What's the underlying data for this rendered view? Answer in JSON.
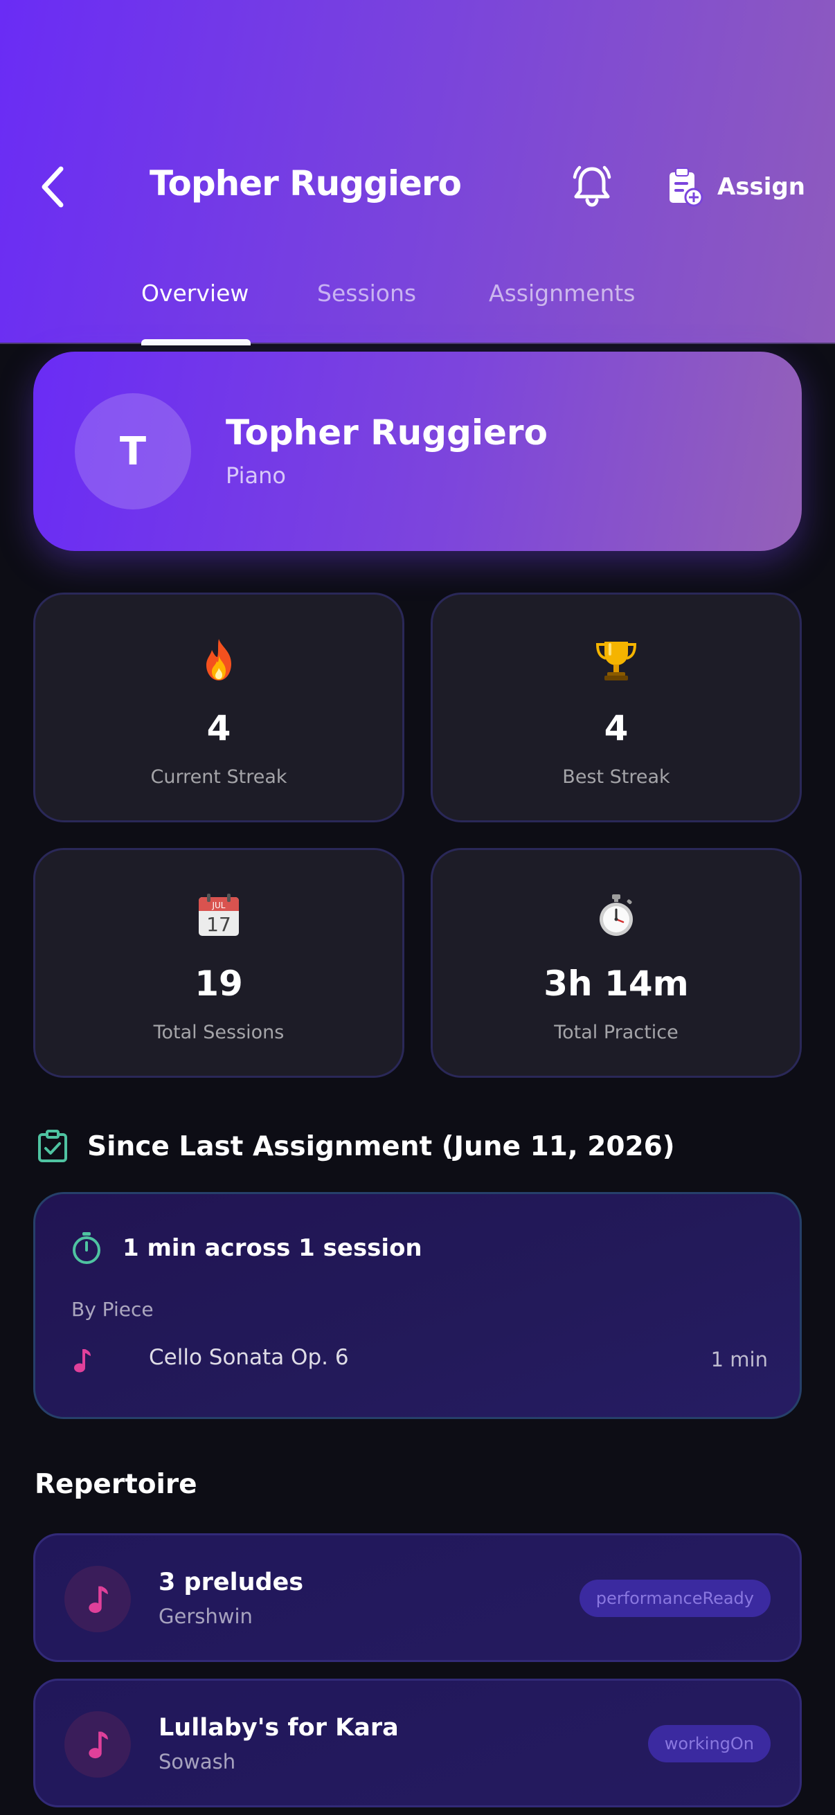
{
  "header": {
    "title": "Topher Ruggiero",
    "assign_label": "Assign",
    "icons": [
      "chevron-left-icon",
      "bell-icon",
      "clipboard-add-icon"
    ]
  },
  "tabs": [
    {
      "label": "Overview",
      "active": true
    },
    {
      "label": "Sessions",
      "active": false
    },
    {
      "label": "Assignments",
      "active": false
    }
  ],
  "profile": {
    "avatar_initial": "T",
    "name": "Topher Ruggiero",
    "instrument": "Piano"
  },
  "stats": [
    {
      "icon": "fire-icon",
      "value": "4",
      "label": "Current Streak"
    },
    {
      "icon": "trophy-icon",
      "value": "4",
      "label": "Best Streak"
    },
    {
      "icon": "calendar-icon",
      "value": "19",
      "label": "Total Sessions",
      "calendar_month": "JUL",
      "calendar_day": "17"
    },
    {
      "icon": "stopwatch-icon",
      "value": "3h 14m",
      "label": "Total Practice"
    }
  ],
  "since_last": {
    "title": "Since Last Assignment (June 11, 2026)",
    "summary": "1 min across 1 session",
    "by_piece_label": "By Piece",
    "pieces": [
      {
        "name": "Cello Sonata Op. 6",
        "time": "1 min"
      }
    ]
  },
  "repertoire": {
    "title": "Repertoire",
    "items": [
      {
        "name": "3 preludes",
        "composer": "Gershwin",
        "status": "performanceReady"
      },
      {
        "name": "Lullaby's for Kara",
        "composer": "Sowash",
        "status": "workingOn"
      }
    ]
  },
  "colors": {
    "accent_purple": "#6a2cf5",
    "accent_teal": "#4fc3a1",
    "accent_pink": "#e0409a",
    "background": "#0d0d15"
  }
}
